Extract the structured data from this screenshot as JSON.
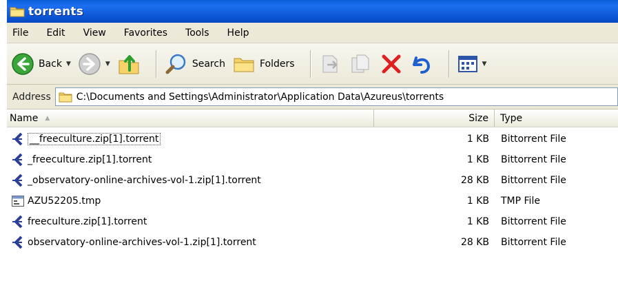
{
  "window": {
    "title": "torrents"
  },
  "menu": {
    "items": [
      "File",
      "Edit",
      "View",
      "Favorites",
      "Tools",
      "Help"
    ]
  },
  "toolbar": {
    "back_label": "Back",
    "search_label": "Search",
    "folders_label": "Folders"
  },
  "address": {
    "label": "Address",
    "path": "C:\\Documents and Settings\\Administrator\\Application Data\\Azureus\\torrents"
  },
  "columns": {
    "name": "Name",
    "size": "Size",
    "type": "Type"
  },
  "files": [
    {
      "name": "__freeculture.zip[1].torrent",
      "size": "1 KB",
      "type": "Bittorrent File",
      "icon": "torrent-icon"
    },
    {
      "name": "_freeculture.zip[1].torrent",
      "size": "1 KB",
      "type": "Bittorrent File",
      "icon": "torrent-icon"
    },
    {
      "name": "_observatory-online-archives-vol-1.zip[1].torrent",
      "size": "28 KB",
      "type": "Bittorrent File",
      "icon": "torrent-icon"
    },
    {
      "name": "AZU52205.tmp",
      "size": "1 KB",
      "type": "TMP File",
      "icon": "tmp-file-icon"
    },
    {
      "name": "freeculture.zip[1].torrent",
      "size": "1 KB",
      "type": "Bittorrent File",
      "icon": "torrent-icon"
    },
    {
      "name": "observatory-online-archives-vol-1.zip[1].torrent",
      "size": "28 KB",
      "type": "Bittorrent File",
      "icon": "torrent-icon"
    }
  ],
  "colors": {
    "titlebar": "#0a5fd8",
    "chrome": "#ece9d8",
    "delete_red": "#e02020"
  }
}
